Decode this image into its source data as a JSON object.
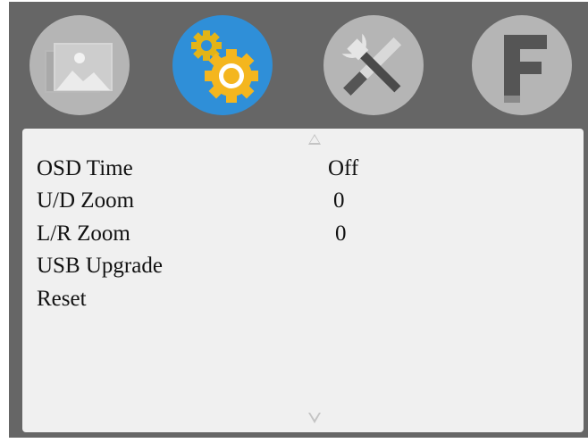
{
  "tabs": [
    {
      "name": "picture",
      "icon": "picture-icon",
      "active": false
    },
    {
      "name": "settings",
      "icon": "gears-icon",
      "active": true
    },
    {
      "name": "tools",
      "icon": "tools-icon",
      "active": false
    },
    {
      "name": "factory",
      "icon": "f-letter-icon",
      "active": false
    }
  ],
  "colors": {
    "frame": "#666666",
    "panel": "#f0f0f0",
    "active_tab": "#2f8fd8",
    "inactive_tab": "#b5b5b5",
    "text": "#111111"
  },
  "menu": {
    "scroll_up_icon": "triangle-up-icon",
    "scroll_down_icon": "triangle-down-icon",
    "items": [
      {
        "label": "OSD Time",
        "value": "Off"
      },
      {
        "label": "U/D Zoom",
        "value": "0"
      },
      {
        "label": "L/R Zoom",
        "value": "0"
      },
      {
        "label": "USB Upgrade",
        "value": ""
      },
      {
        "label": "Reset",
        "value": ""
      }
    ]
  }
}
